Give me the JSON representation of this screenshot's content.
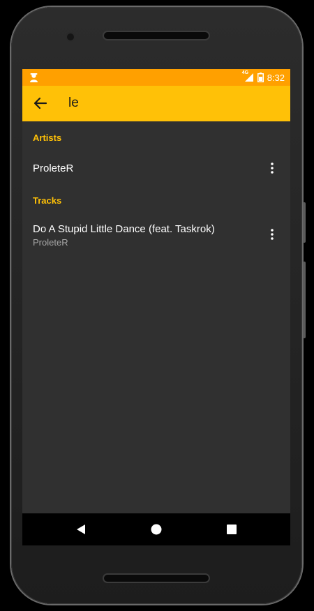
{
  "status_bar": {
    "time": "8:32",
    "network_label": "4G",
    "background_color": "#FFA000",
    "icons": [
      "notification-icon",
      "signal-icon",
      "battery-icon"
    ]
  },
  "toolbar": {
    "background_color": "#FFC107",
    "back_icon": "arrow-back-icon",
    "search_value": "le"
  },
  "results": {
    "artists_header": "Artists",
    "artists": [
      {
        "name": "ProleteR"
      }
    ],
    "tracks_header": "Tracks",
    "tracks": [
      {
        "title": "Do A Stupid Little Dance (feat. Taskrok)",
        "artist": "ProleteR"
      }
    ]
  },
  "nav_bar": {
    "icons": [
      "back-icon",
      "home-icon",
      "recents-icon"
    ]
  },
  "theme": {
    "accent": "#FFC107",
    "background": "#303030",
    "primary_text": "#FFFFFF",
    "secondary_text": "#A8A8A8"
  }
}
